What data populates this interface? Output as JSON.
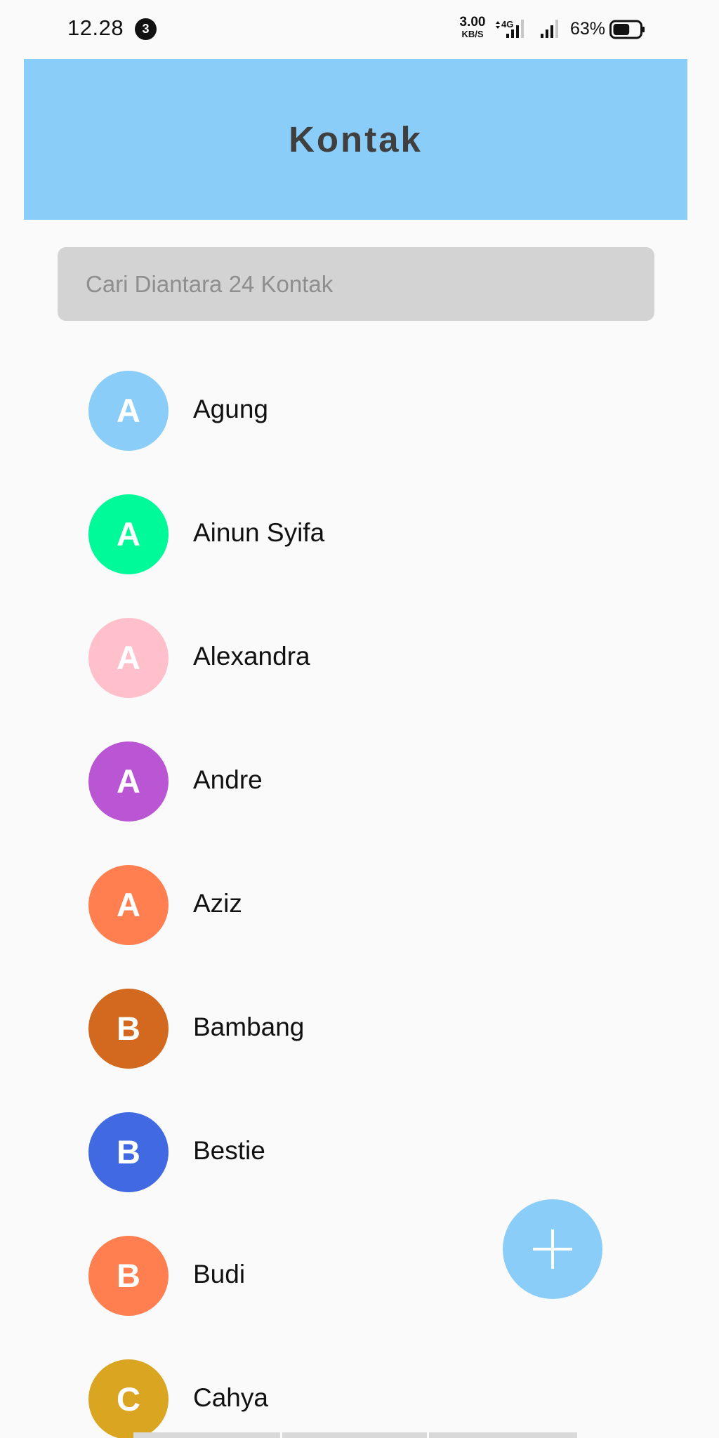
{
  "status_bar": {
    "time": "12.28",
    "notification_count": "3",
    "network_speed_value": "3.00",
    "network_speed_unit": "KB/S",
    "network_type": "4G",
    "battery_percent": "63%",
    "battery_level": 0.63,
    "icons": [
      "data-transfer-icon",
      "signal-icon",
      "signal-icon",
      "battery-icon"
    ]
  },
  "app_bar": {
    "title": "Kontak",
    "background_color": "#89cdf8"
  },
  "search": {
    "placeholder": "Cari Diantara 24 Kontak",
    "value": ""
  },
  "contacts": [
    {
      "initial": "A",
      "name": "Agung",
      "color": "#89cdf8"
    },
    {
      "initial": "A",
      "name": "Ainun Syifa",
      "color": "#00fa9a"
    },
    {
      "initial": "A",
      "name": "Alexandra",
      "color": "#ffc0cb"
    },
    {
      "initial": "A",
      "name": "Andre",
      "color": "#ba55d3"
    },
    {
      "initial": "A",
      "name": "Aziz",
      "color": "#ff7f50"
    },
    {
      "initial": "B",
      "name": "Bambang",
      "color": "#d2691e"
    },
    {
      "initial": "B",
      "name": "Bestie",
      "color": "#4169e1"
    },
    {
      "initial": "B",
      "name": "Budi",
      "color": "#ff7f50"
    },
    {
      "initial": "C",
      "name": "Cahya",
      "color": "#daa520"
    }
  ],
  "fab": {
    "icon": "plus-icon",
    "color": "#89cdf8"
  }
}
